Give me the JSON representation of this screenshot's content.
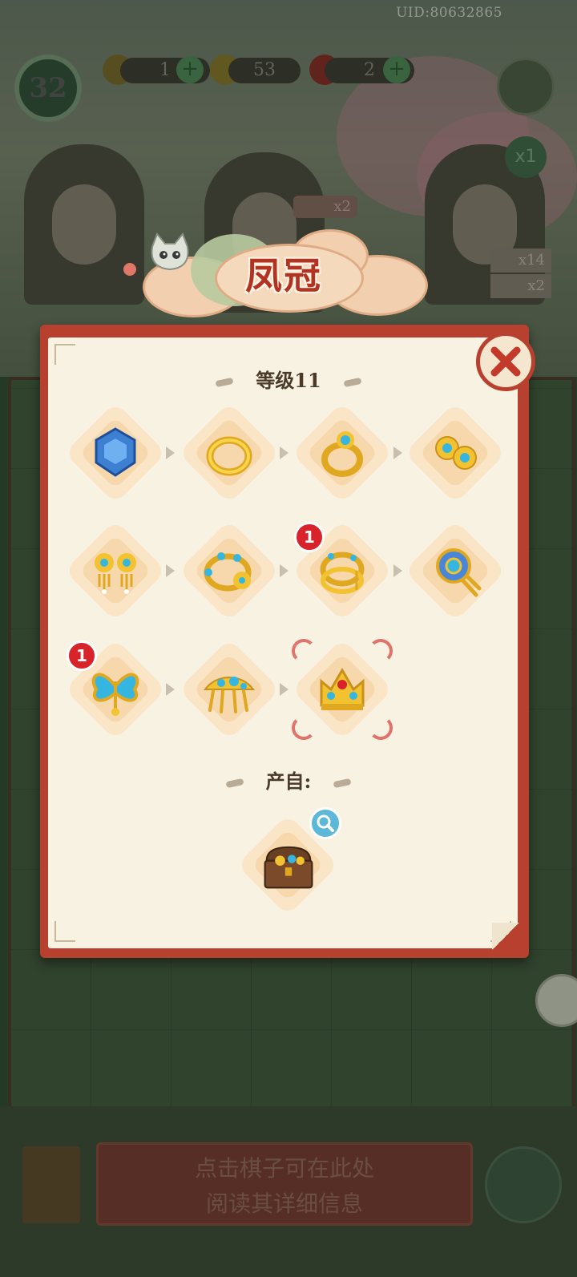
{
  "hud": {
    "uid": "UID:80632865",
    "level": "32",
    "energy": "1",
    "coins": "53",
    "gems": "2",
    "multiplier": "x1",
    "bonus_x2": "x2",
    "side_count_1": "x14",
    "side_count_2": "x2"
  },
  "dialog": {
    "title": "凤冠",
    "level_label": "等级11",
    "source_label": "产自:",
    "items": [
      {
        "name": "sapphire",
        "icon": "blue-gem-icon"
      },
      {
        "name": "gold-ring",
        "icon": "gold-ring-icon"
      },
      {
        "name": "gem-ring",
        "icon": "gem-ring-icon"
      },
      {
        "name": "flower-studs",
        "icon": "flower-earrings-icon"
      },
      {
        "name": "tassel-earrings",
        "icon": "tassel-earrings-icon"
      },
      {
        "name": "beaded-bangle",
        "icon": "beaded-bangle-icon"
      },
      {
        "name": "dragon-bangle",
        "icon": "dragon-bangle-icon",
        "badge": "1"
      },
      {
        "name": "flower-hairpin",
        "icon": "flower-hairpin-icon"
      },
      {
        "name": "butterfly-hairpin",
        "icon": "butterfly-hairpin-icon",
        "badge": "1"
      },
      {
        "name": "gold-hair-comb",
        "icon": "hair-comb-icon"
      },
      {
        "name": "phoenix-crown",
        "icon": "phoenix-crown-icon"
      }
    ],
    "source_icon": "treasure-chest-icon"
  },
  "bottom": {
    "hint_line1": "点击棋子可在此处",
    "hint_line2": "阅读其详细信息"
  },
  "colors": {
    "frame_red": "#b8402f",
    "paper": "#f8f2e3",
    "title_red": "#b23322",
    "badge_red": "#d8232a",
    "gold": "#f2c230",
    "turquoise": "#35b6e0"
  }
}
